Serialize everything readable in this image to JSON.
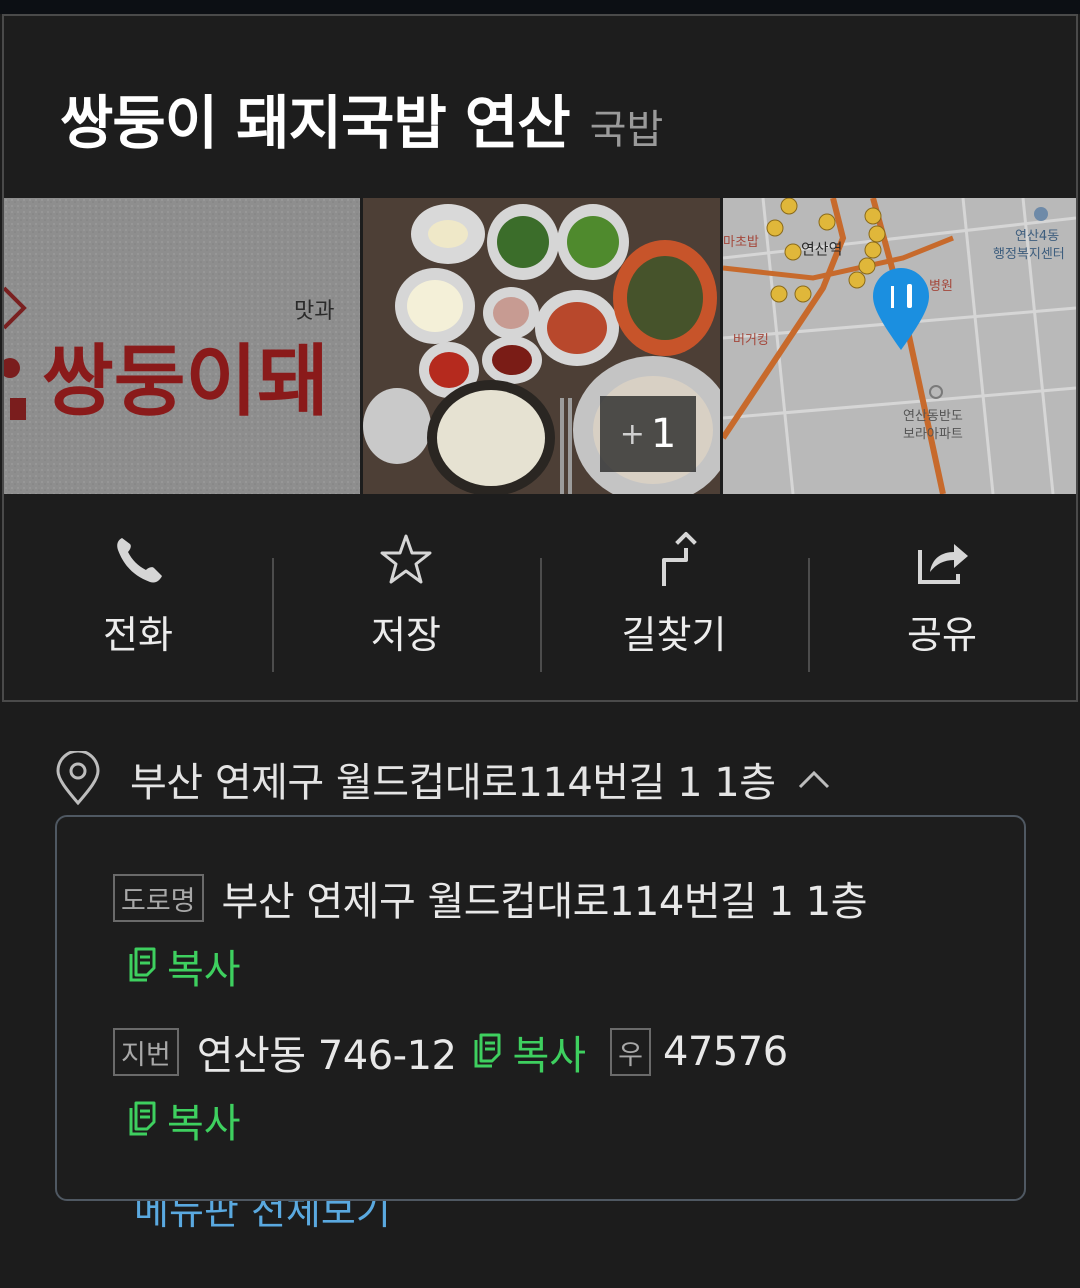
{
  "place": {
    "name": "쌍둥이 돼지국밥 연산",
    "category": "국밥"
  },
  "photos": {
    "more_count": "1",
    "plus_symbol": "+",
    "sign_text": "쌍둥이돼",
    "sign_small": "맛과 ",
    "map_labels": {
      "station": "연산역",
      "community_center": "연산4동 행정복지센터",
      "apartment": "연산동반도 보라아파트",
      "restaurant1": "마초밥",
      "restaurant2": "버거킹",
      "hospital": "병원"
    }
  },
  "actions": [
    {
      "label": "전화",
      "icon": "phone-icon"
    },
    {
      "label": "저장",
      "icon": "star-icon"
    },
    {
      "label": "길찾기",
      "icon": "directions-icon"
    },
    {
      "label": "공유",
      "icon": "share-icon"
    }
  ],
  "address": {
    "summary": "부산 연제구 월드컵대로114번길 1 1층",
    "road_tag": "도로명",
    "road": "부산 연제구 월드컵대로114번길 1 1층",
    "lot_tag": "지번",
    "lot": "연산동 746-12",
    "zip_tag": "우",
    "zip": "47576",
    "copy_label": "복사"
  },
  "peek_text": "메뉴판 전체보기",
  "colors": {
    "background": "#1c1c1c",
    "accent_green": "#3ed05f",
    "link_blue": "#5aa9e0",
    "map_pin": "#1b8fe0"
  }
}
